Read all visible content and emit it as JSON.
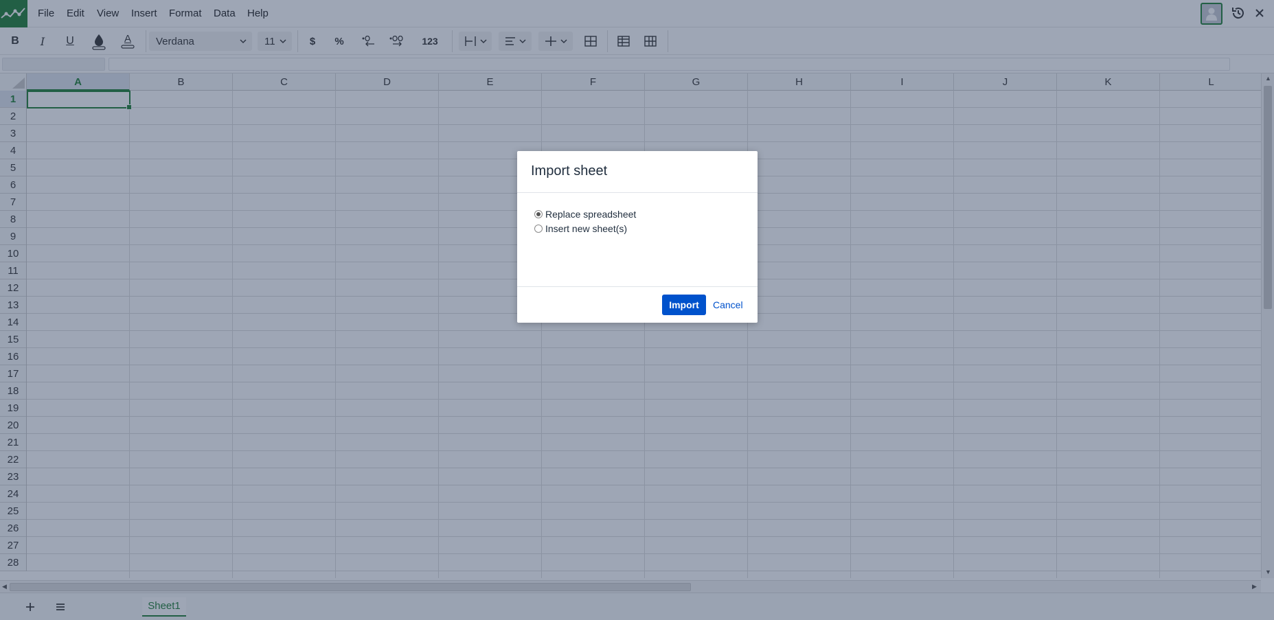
{
  "menubar": {
    "items": [
      "File",
      "Edit",
      "View",
      "Insert",
      "Format",
      "Data",
      "Help"
    ]
  },
  "toolbar": {
    "bold": "B",
    "italic": "I",
    "underline": "U",
    "text_color": "A",
    "font_family": "Verdana",
    "font_size": "11",
    "currency": "$",
    "percent": "%",
    "number_format": "123"
  },
  "grid": {
    "columns": [
      "A",
      "B",
      "C",
      "D",
      "E",
      "F",
      "G",
      "H",
      "I",
      "J",
      "K",
      "L"
    ],
    "rows": [
      "1",
      "2",
      "3",
      "4",
      "5",
      "6",
      "7",
      "8",
      "9",
      "10",
      "11",
      "12",
      "13",
      "14",
      "15",
      "16",
      "17",
      "18",
      "19",
      "20",
      "21",
      "22",
      "23",
      "24",
      "25",
      "26",
      "27",
      "28"
    ],
    "selected_cell": "A1"
  },
  "bottombar": {
    "sheet_tab": "Sheet1"
  },
  "dialog": {
    "title": "Import sheet",
    "options": [
      "Replace spreadsheet",
      "Insert new sheet(s)"
    ],
    "selected_option": "Replace spreadsheet",
    "import_label": "Import",
    "cancel_label": "Cancel"
  },
  "colors": {
    "accent": "#1e7e34",
    "primary_button": "#0052cc"
  }
}
